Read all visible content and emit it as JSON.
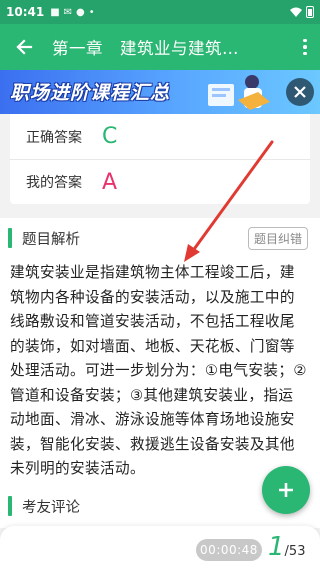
{
  "status_bar": {
    "time": "10:41"
  },
  "app_bar": {
    "title": "第一章　建筑业与建筑…"
  },
  "banner": {
    "text": "职场进阶课程汇总"
  },
  "answers": {
    "correct_label": "正确答案",
    "correct_value": "C",
    "mine_label": "我的答案",
    "mine_value": "A"
  },
  "analysis": {
    "title": "题目解析",
    "error_button": "题目纠错",
    "text": "建筑安装业是指建筑物主体工程竣工后，建筑物内各种设备的安装活动，以及施工中的线路敷设和管道安装活动，不包括工程收尾的装饰，如对墙面、地板、天花板、门窗等处理活动。可进一步划分为：①电气安装；②管道和设备安装；③其他建筑安装业，指运动地面、滑冰、游泳设施等体育场地设施安装，智能化安装、救援逃生设备安装及其他未列明的安装活动。"
  },
  "comments": {
    "title": "考友评论"
  },
  "bottom_bar": {
    "timer": "00:00:48",
    "progress_current": "1",
    "progress_total": "/53"
  },
  "colors": {
    "primary": "#2ab673",
    "correct": "#2ab673",
    "wrong": "#e8336d",
    "arrow": "#e03a32"
  }
}
